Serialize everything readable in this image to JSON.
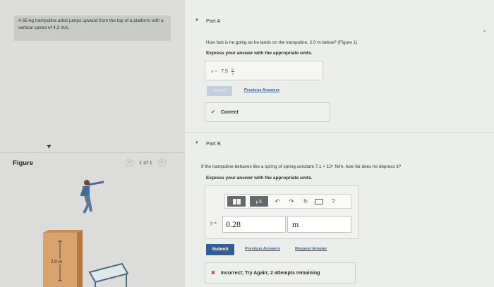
{
  "problem": {
    "statement": "A 65-kg trampoline artist jumps upward from the top of a platform with a vertical speed of 4.2 m/s."
  },
  "figure": {
    "label": "Figure",
    "pager": {
      "text": "1 of 1",
      "prev": "<",
      "next": ">"
    },
    "height_label": "2.0 m"
  },
  "part_a": {
    "title": "Part A",
    "question": "How fast is he going as he lands on the trampoline, 2.0 m below? (Figure 1)",
    "instruction": "Express your answer with the appropriate units.",
    "answer": {
      "var": "v =",
      "value": "7.5",
      "unit_num": "m",
      "unit_den": "s"
    },
    "submit_label": "Submit",
    "prev_answers_label": "Previous Answers",
    "feedback": "Correct"
  },
  "part_b": {
    "title": "Part B",
    "question": "If the trampoline behaves like a spring of spring constant 7.1 × 10⁴ N/m, how far does he depress it?",
    "instruction": "Express your answer with the appropriate units.",
    "toolbar": {
      "mu": "μÅ",
      "help": "?"
    },
    "answer": {
      "var": "y =",
      "value": "0.28",
      "unit": "m"
    },
    "submit_label": "Submit",
    "prev_answers_label": "Previous Answers",
    "request_label": "Request Answer",
    "feedback": "Incorrect; Try Again; 2 attempts remaining"
  }
}
